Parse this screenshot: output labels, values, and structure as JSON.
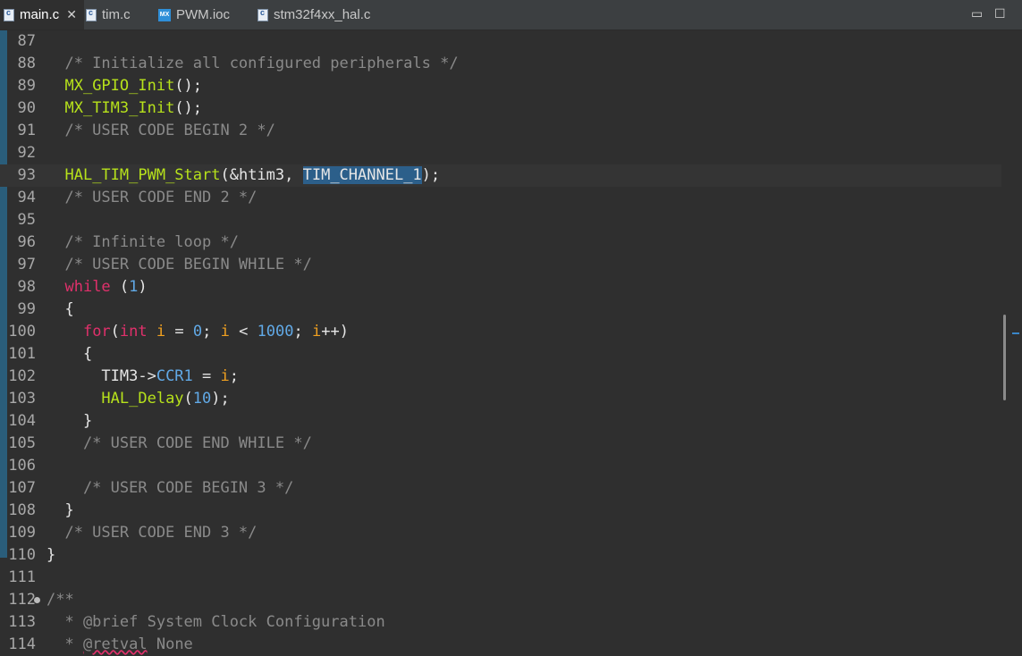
{
  "tabs": [
    {
      "label": "main.c",
      "active": true,
      "icon": "c-file-icon",
      "closable": true
    },
    {
      "label": "tim.c",
      "active": false,
      "icon": "c-file-icon"
    },
    {
      "label": "PWM.ioc",
      "active": false,
      "icon": "mx-ioc-icon",
      "icon_text": "MX"
    },
    {
      "label": "stm32f4xx_hal.c",
      "active": false,
      "icon": "c-file-icon"
    }
  ],
  "window_controls": {
    "minimize": "▭",
    "maximize": "☐"
  },
  "editor": {
    "current_line": 93,
    "lines": [
      {
        "n": "87",
        "text": ""
      },
      {
        "n": "88",
        "text": "  /* Initialize all configured peripherals */"
      },
      {
        "n": "89",
        "text": "  MX_GPIO_Init();"
      },
      {
        "n": "90",
        "text": "  MX_TIM3_Init();"
      },
      {
        "n": "91",
        "text": "  /* USER CODE BEGIN 2 */"
      },
      {
        "n": "92",
        "text": ""
      },
      {
        "n": "93",
        "text": "  HAL_TIM_PWM_Start(&htim3, TIM_CHANNEL_1);"
      },
      {
        "n": "94",
        "text": "  /* USER CODE END 2 */"
      },
      {
        "n": "95",
        "text": ""
      },
      {
        "n": "96",
        "text": "  /* Infinite loop */"
      },
      {
        "n": "97",
        "text": "  /* USER CODE BEGIN WHILE */"
      },
      {
        "n": "98",
        "text": "  while (1)"
      },
      {
        "n": "99",
        "text": "  {"
      },
      {
        "n": "100",
        "text": "    for(int i = 0; i < 1000; i++)"
      },
      {
        "n": "101",
        "text": "    {"
      },
      {
        "n": "102",
        "text": "      TIM3->CCR1 = i;"
      },
      {
        "n": "103",
        "text": "      HAL_Delay(10);"
      },
      {
        "n": "104",
        "text": "    }"
      },
      {
        "n": "105",
        "text": "    /* USER CODE END WHILE */"
      },
      {
        "n": "106",
        "text": ""
      },
      {
        "n": "107",
        "text": "    /* USER CODE BEGIN 3 */"
      },
      {
        "n": "108",
        "text": "  }"
      },
      {
        "n": "109",
        "text": "  /* USER CODE END 3 */"
      },
      {
        "n": "110",
        "text": "}"
      },
      {
        "n": "111",
        "text": ""
      },
      {
        "n": "112",
        "text": "/**"
      },
      {
        "n": "113",
        "text": "  * @brief System Clock Configuration"
      },
      {
        "n": "114",
        "text": "  * @retval None"
      }
    ]
  }
}
